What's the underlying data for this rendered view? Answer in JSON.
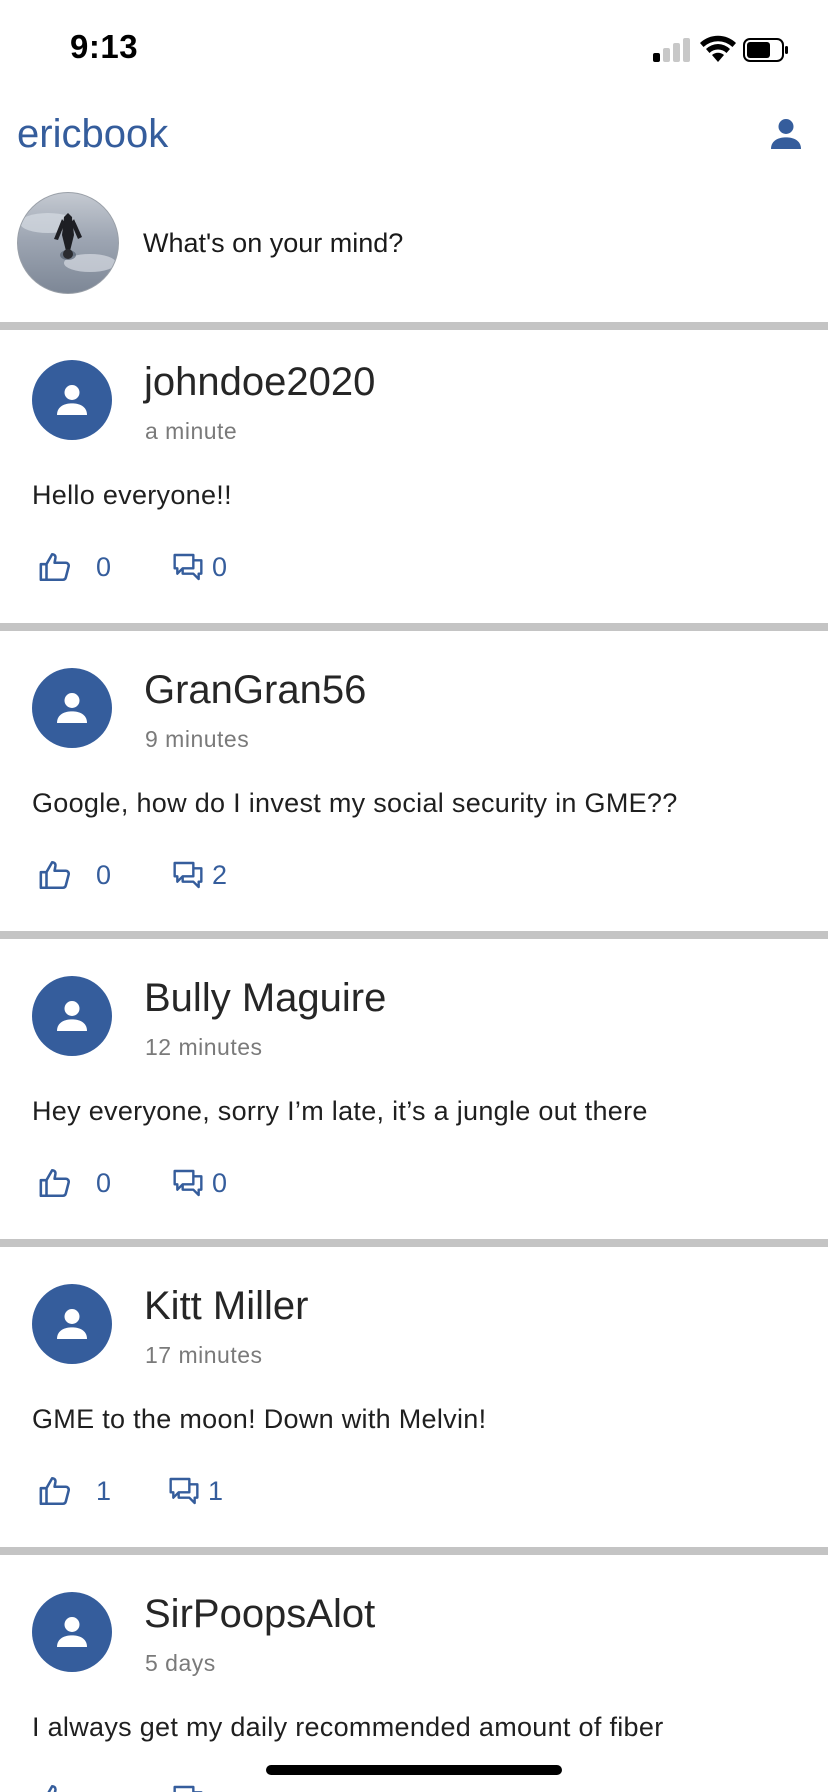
{
  "status_bar": {
    "time": "9:13"
  },
  "app_bar": {
    "title": "ericbook",
    "profile_icon": "person-icon"
  },
  "composer": {
    "prompt": "What's on your mind?"
  },
  "colors": {
    "brand": "#355d9c",
    "divider": "#c4c4c4",
    "meta_text": "#7a7a7a"
  },
  "posts": [
    {
      "author": "johndoe2020",
      "time": "a minute",
      "text": "Hello everyone!!",
      "likes": "0",
      "comments": "0"
    },
    {
      "author": "GranGran56",
      "time": "9 minutes",
      "text": "Google, how do I invest my social security in GME??",
      "likes": "0",
      "comments": "2"
    },
    {
      "author": "Bully Maguire",
      "time": "12 minutes",
      "text": "Hey everyone, sorry I’m late, it’s a jungle out there",
      "likes": "0",
      "comments": "0"
    },
    {
      "author": "Kitt Miller",
      "time": "17 minutes",
      "text": "GME to the moon! Down with Melvin!",
      "likes": "1",
      "comments": "1"
    },
    {
      "author": "SirPoopsAlot",
      "time": "5 days",
      "text": "I always get my daily recommended amount of fiber",
      "likes": "",
      "comments": ""
    }
  ]
}
